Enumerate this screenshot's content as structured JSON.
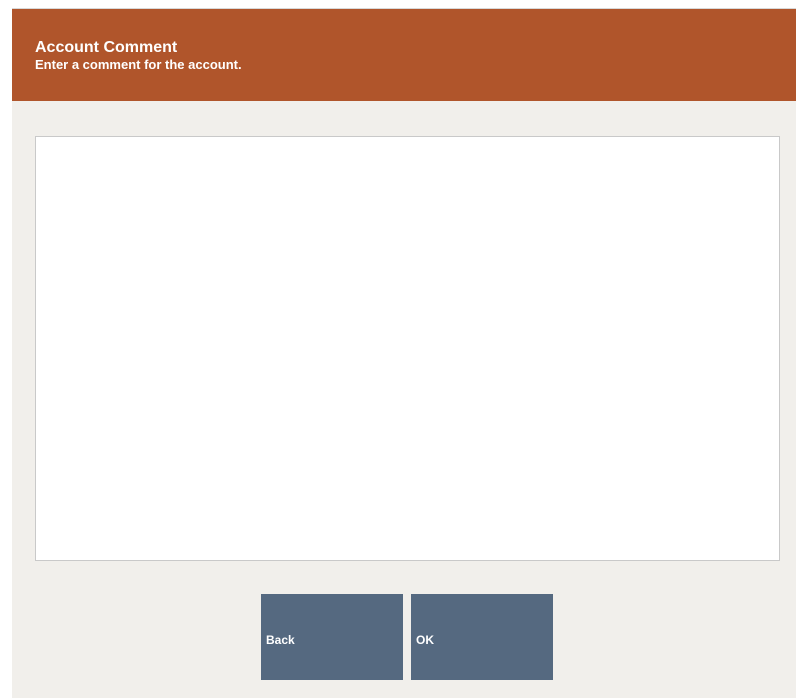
{
  "header": {
    "title": "Account Comment",
    "subtitle": "Enter a comment for the account.",
    "color": "#b0552b"
  },
  "comment": {
    "value": ""
  },
  "buttons": {
    "back_label": "Back",
    "ok_label": "OK",
    "color": "#556980"
  }
}
